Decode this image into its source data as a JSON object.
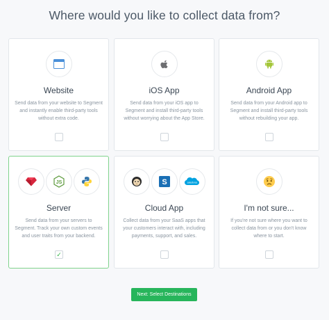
{
  "page": {
    "title": "Where would you like to collect data from?"
  },
  "cards": [
    {
      "title": "Website",
      "desc": "Send data from your website to Segment and instantly enable third-party tools without extra code.",
      "selected": false
    },
    {
      "title": "iOS App",
      "desc": "Send data from your iOS app to Segment and install third-party tools without worrying about the App Store.",
      "selected": false
    },
    {
      "title": "Android App",
      "desc": "Send data from your Android app to Segment and install third-party tools without rebuilding your app.",
      "selected": false
    },
    {
      "title": "Server",
      "desc": "Send data from your servers to Segment. Track your own custom events and user traits from your backend.",
      "selected": true,
      "check": "✓"
    },
    {
      "title": "Cloud App",
      "desc": "Collect data from your SaaS apps that your customers interact with, including payments, support, and sales.",
      "selected": false
    },
    {
      "title": "I'm not sure...",
      "desc": "If you're not sure where you want to collect data from or you don't know where to start.",
      "selected": false
    }
  ],
  "icons": {
    "website": "browser-window-icon",
    "ios": "apple-icon",
    "android": "android-icon",
    "server": [
      "ruby-icon",
      "nodejs-icon",
      "python-icon"
    ],
    "cloud": [
      "mailchimp-icon",
      "stripe-icon",
      "salesforce-icon"
    ],
    "unsure": "worried-face-icon"
  },
  "cloud_icon_text": {
    "stripe": "S",
    "salesforce": "salesforce"
  },
  "actions": {
    "next_label": "Next: Select Destinations"
  },
  "colors": {
    "selected_border": "#7fd38c",
    "button_bg": "#27b55b",
    "check": "#2fb344",
    "android": "#a4c639"
  }
}
